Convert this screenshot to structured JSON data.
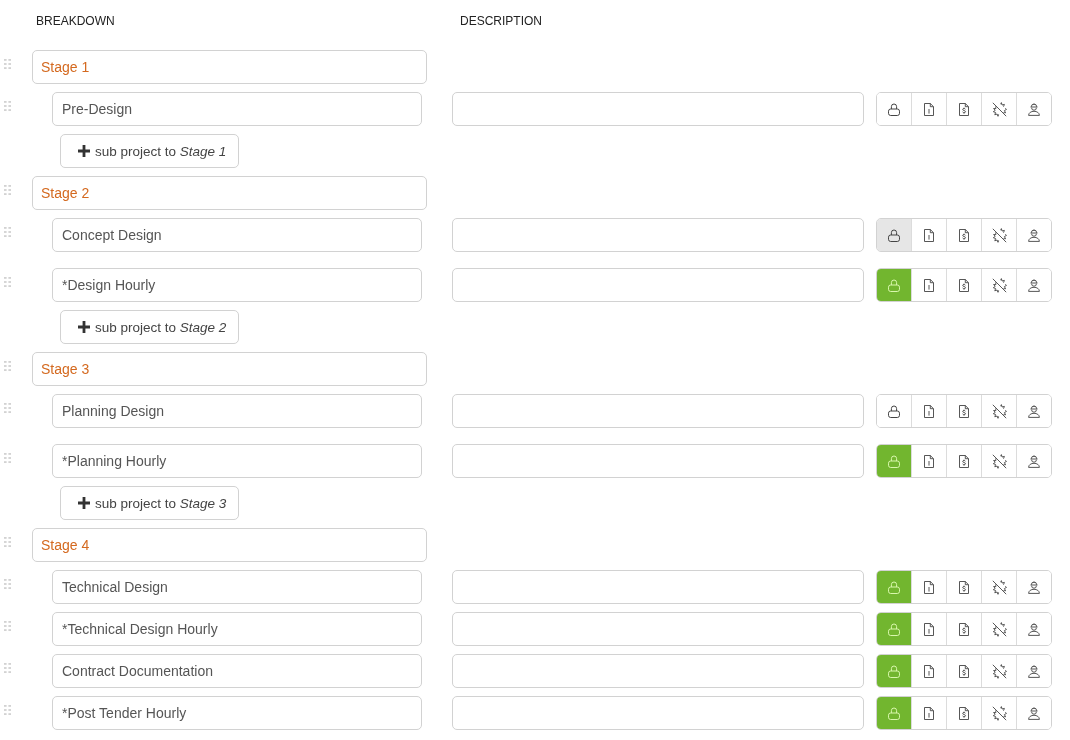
{
  "columns": [
    {
      "label": "BREAKDOWN"
    },
    {
      "label": "DESCRIPTION"
    }
  ],
  "stages": [
    {
      "name": "Stage 1",
      "subprojects": [
        {
          "name": "Pre-Design",
          "locked": false,
          "highlighted": false
        }
      ],
      "add_label": "sub project to *Stage 1*"
    },
    {
      "name": "Stage 2",
      "subprojects": [
        {
          "name": "Concept Design",
          "locked": false,
          "highlighted": true
        },
        {
          "name": "*Design Hourly",
          "locked": true,
          "highlighted": false
        }
      ],
      "add_label": "sub project to *Stage 2*"
    },
    {
      "name": "Stage 3",
      "subprojects": [
        {
          "name": "Planning Design",
          "locked": false,
          "highlighted": false
        },
        {
          "name": "*Planning Hourly",
          "locked": true,
          "highlighted": false
        }
      ],
      "add_label": "sub project to *Stage 3*"
    },
    {
      "name": "Stage 4",
      "subprojects": [
        {
          "name": "Technical Design",
          "locked": true,
          "highlighted": false
        },
        {
          "name": "*Technical Design Hourly",
          "locked": true,
          "highlighted": false
        },
        {
          "name": "Contract Documentation",
          "locked": true,
          "highlighted": false
        },
        {
          "name": "*Post Tender Hourly",
          "locked": true,
          "highlighted": false
        }
      ]
    }
  ]
}
